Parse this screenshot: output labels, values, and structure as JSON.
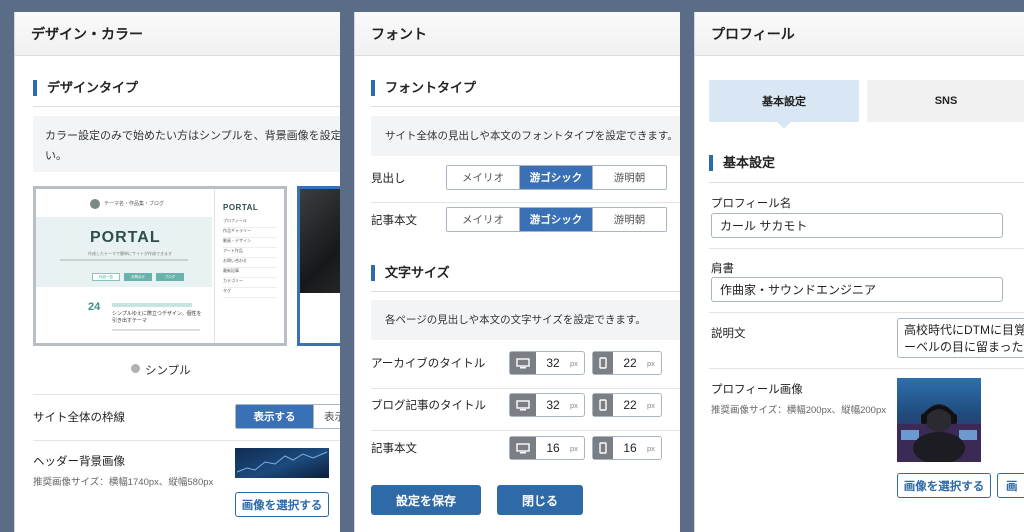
{
  "design": {
    "header": "デザイン・カラー",
    "section_title": "デザインタイプ",
    "description_line1": "カラー設定のみで始めたい方はシンプルを、背景画像を設定してビジュア",
    "description_line2": "い。",
    "theme_preview": {
      "logo_small": "テーマ名・作品集・ブログ",
      "logo_big": "PORTAL",
      "logo_tagline": "作成したテーマで簡単にサイトが作成できます",
      "side_logo": "PORTAL",
      "side_items": [
        "プロフィール",
        "作品ギャラリー",
        "動画・デザイン",
        "アート作品",
        "お問い合わせ",
        "最新記事",
        "カテゴリー",
        "タグ"
      ],
      "button_labels": [
        "作品一覧",
        "お問合せ",
        "ブログ"
      ],
      "date_day": "24",
      "post_title": "シンプルゆえに際立つデザイン。個性を引き出すテーマ"
    },
    "selected_design": "シンプル",
    "frame_label": "サイト全体の枠線",
    "frame_options": [
      "表示する",
      "表示"
    ],
    "header_bg_label": "ヘッダー背景画像",
    "header_bg_note": "推奨画像サイズ：横幅1740px、縦幅580px",
    "choose_image": "画像を選択する"
  },
  "font": {
    "header": "フォント",
    "type_title": "フォントタイプ",
    "type_desc": "サイト全体の見出しや本文のフォントタイプを設定できます。",
    "rows": [
      {
        "label": "見出し",
        "options": [
          "メイリオ",
          "游ゴシック",
          "游明朝"
        ],
        "selected": 1
      },
      {
        "label": "記事本文",
        "options": [
          "メイリオ",
          "游ゴシック",
          "游明朝"
        ],
        "selected": 1
      }
    ],
    "size_title": "文字サイズ",
    "size_desc": "各ページの見出しや本文の文字サイズを設定できます。",
    "size_rows": [
      {
        "label": "アーカイブのタイトル",
        "pc": "32",
        "mobile": "22"
      },
      {
        "label": "ブログ記事のタイトル",
        "pc": "32",
        "mobile": "22"
      },
      {
        "label": "記事本文",
        "pc": "16",
        "mobile": "16"
      }
    ],
    "unit": "px",
    "save": "設定を保存",
    "close": "閉じる"
  },
  "profile": {
    "header": "プロフィール",
    "tabs": [
      "基本設定",
      "SNS"
    ],
    "section_title": "基本設定",
    "name_label": "プロフィール名",
    "name_value": "カール サカモト",
    "title_label": "肩書",
    "title_value": "作曲家・サウンドエンジニア",
    "desc_label": "説明文",
    "desc_line1": "高校時代にDTMに目覚め",
    "desc_line2": "ーベルの目に留まったこ",
    "image_label": "プロフィール画像",
    "image_note": "推奨画像サイズ：横幅200px、縦幅200px",
    "choose_image": "画像を選択する",
    "choose_image_2": "画"
  },
  "colors": {
    "accent": "#2f6aa8",
    "active_segment": "#3a70b5",
    "tab_active_bg": "#d9e7f5",
    "backdrop": "#5b6d86"
  }
}
